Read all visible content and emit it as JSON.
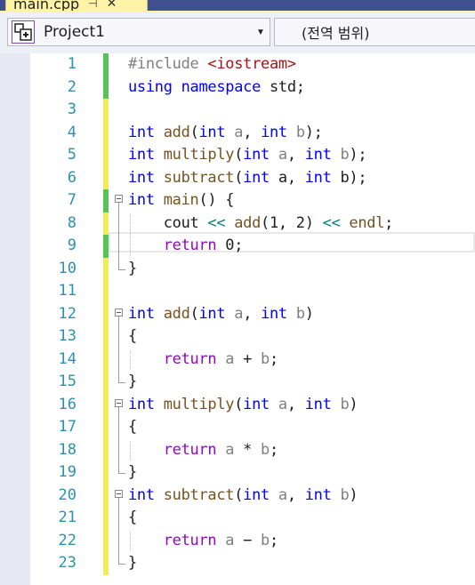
{
  "tab": {
    "filename": "main.cpp",
    "pin_glyph": "⊣",
    "close_glyph": "✕"
  },
  "navbar": {
    "project": "Project1",
    "scope": "(전역 범위)"
  },
  "colors": {
    "keyword": "#0000ff",
    "function": "#74531f",
    "preprocessor": "#808080",
    "string": "#a31515",
    "param": "#808080",
    "control": "#8f08c4",
    "line_number": "#2b91af",
    "change_saved": "#57c15c",
    "change_unsaved": "#f1ec5a"
  },
  "lines": [
    {
      "n": "1",
      "change": "saved",
      "tokens": [
        [
          "pp",
          "#include "
        ],
        [
          "str",
          "<iostream>"
        ]
      ]
    },
    {
      "n": "2",
      "change": "saved",
      "tokens": [
        [
          "kw",
          "using"
        ],
        [
          "id",
          " "
        ],
        [
          "kw",
          "namespace"
        ],
        [
          "id",
          " std;"
        ]
      ]
    },
    {
      "n": "3",
      "change": "unsaved",
      "tokens": []
    },
    {
      "n": "4",
      "change": "unsaved",
      "tokens": [
        [
          "kw",
          "int"
        ],
        [
          "id",
          " "
        ],
        [
          "fn",
          "add"
        ],
        [
          "id",
          "("
        ],
        [
          "kw",
          "int"
        ],
        [
          "id",
          " "
        ],
        [
          "par",
          "a"
        ],
        [
          "id",
          ", "
        ],
        [
          "kw",
          "int"
        ],
        [
          "id",
          " "
        ],
        [
          "par",
          "b"
        ],
        [
          "id",
          ");"
        ]
      ]
    },
    {
      "n": "5",
      "change": "unsaved",
      "tokens": [
        [
          "kw",
          "int"
        ],
        [
          "id",
          " "
        ],
        [
          "fn",
          "multiply"
        ],
        [
          "id",
          "("
        ],
        [
          "kw",
          "int"
        ],
        [
          "id",
          " "
        ],
        [
          "par",
          "a"
        ],
        [
          "id",
          ", "
        ],
        [
          "kw",
          "int"
        ],
        [
          "id",
          " "
        ],
        [
          "par",
          "b"
        ],
        [
          "id",
          ");"
        ]
      ]
    },
    {
      "n": "6",
      "change": "unsaved",
      "tokens": [
        [
          "kw",
          "int"
        ],
        [
          "id",
          " "
        ],
        [
          "fn",
          "subtract"
        ],
        [
          "id",
          "("
        ],
        [
          "kw",
          "int"
        ],
        [
          "id",
          " a, "
        ],
        [
          "kw",
          "int"
        ],
        [
          "id",
          " b);"
        ]
      ]
    },
    {
      "n": "7",
      "change": "saved",
      "tokens": [
        [
          "kw",
          "int"
        ],
        [
          "id",
          " "
        ],
        [
          "fn",
          "main"
        ],
        [
          "id",
          "() {"
        ]
      ]
    },
    {
      "n": "8",
      "change": "unsaved",
      "tokens": [
        [
          "id",
          "    cout "
        ],
        [
          "op",
          "<<"
        ],
        [
          "id",
          " "
        ],
        [
          "fn",
          "add"
        ],
        [
          "id",
          "(1, 2) "
        ],
        [
          "op",
          "<<"
        ],
        [
          "id",
          " "
        ],
        [
          "fn",
          "endl"
        ],
        [
          "id",
          ";"
        ]
      ]
    },
    {
      "n": "9",
      "change": "saved",
      "tokens": [
        [
          "id",
          "    "
        ],
        [
          "ctl",
          "return"
        ],
        [
          "id",
          " 0;"
        ]
      ]
    },
    {
      "n": "10",
      "change": "unsaved",
      "tokens": [
        [
          "id",
          "}"
        ]
      ]
    },
    {
      "n": "11",
      "change": "unsaved",
      "tokens": []
    },
    {
      "n": "12",
      "change": "unsaved",
      "tokens": [
        [
          "kw",
          "int"
        ],
        [
          "id",
          " "
        ],
        [
          "fn",
          "add"
        ],
        [
          "id",
          "("
        ],
        [
          "kw",
          "int"
        ],
        [
          "id",
          " "
        ],
        [
          "par",
          "a"
        ],
        [
          "id",
          ", "
        ],
        [
          "kw",
          "int"
        ],
        [
          "id",
          " "
        ],
        [
          "par",
          "b"
        ],
        [
          "id",
          ")"
        ]
      ]
    },
    {
      "n": "13",
      "change": "unsaved",
      "tokens": [
        [
          "id",
          "{"
        ]
      ]
    },
    {
      "n": "14",
      "change": "unsaved",
      "tokens": [
        [
          "id",
          "    "
        ],
        [
          "ctl",
          "return"
        ],
        [
          "id",
          " "
        ],
        [
          "par",
          "a"
        ],
        [
          "id",
          " + "
        ],
        [
          "par",
          "b"
        ],
        [
          "id",
          ";"
        ]
      ]
    },
    {
      "n": "15",
      "change": "unsaved",
      "tokens": [
        [
          "id",
          "}"
        ]
      ]
    },
    {
      "n": "16",
      "change": "unsaved",
      "tokens": [
        [
          "kw",
          "int"
        ],
        [
          "id",
          " "
        ],
        [
          "fn",
          "multiply"
        ],
        [
          "id",
          "("
        ],
        [
          "kw",
          "int"
        ],
        [
          "id",
          " "
        ],
        [
          "par",
          "a"
        ],
        [
          "id",
          ", "
        ],
        [
          "kw",
          "int"
        ],
        [
          "id",
          " "
        ],
        [
          "par",
          "b"
        ],
        [
          "id",
          ")"
        ]
      ]
    },
    {
      "n": "17",
      "change": "unsaved",
      "tokens": [
        [
          "id",
          "{"
        ]
      ]
    },
    {
      "n": "18",
      "change": "unsaved",
      "tokens": [
        [
          "id",
          "    "
        ],
        [
          "ctl",
          "return"
        ],
        [
          "id",
          " "
        ],
        [
          "par",
          "a"
        ],
        [
          "id",
          " * "
        ],
        [
          "par",
          "b"
        ],
        [
          "id",
          ";"
        ]
      ]
    },
    {
      "n": "19",
      "change": "unsaved",
      "tokens": [
        [
          "id",
          "}"
        ]
      ]
    },
    {
      "n": "20",
      "change": "unsaved",
      "tokens": [
        [
          "kw",
          "int"
        ],
        [
          "id",
          " "
        ],
        [
          "fn",
          "subtract"
        ],
        [
          "id",
          "("
        ],
        [
          "kw",
          "int"
        ],
        [
          "id",
          " "
        ],
        [
          "par",
          "a"
        ],
        [
          "id",
          ", "
        ],
        [
          "kw",
          "int"
        ],
        [
          "id",
          " "
        ],
        [
          "par",
          "b"
        ],
        [
          "id",
          ")"
        ]
      ]
    },
    {
      "n": "21",
      "change": "unsaved",
      "tokens": [
        [
          "id",
          "{"
        ]
      ]
    },
    {
      "n": "22",
      "change": "unsaved",
      "tokens": [
        [
          "id",
          "    "
        ],
        [
          "ctl",
          "return"
        ],
        [
          "id",
          " "
        ],
        [
          "par",
          "a"
        ],
        [
          "id",
          " − "
        ],
        [
          "par",
          "b"
        ],
        [
          "id",
          ";"
        ]
      ]
    },
    {
      "n": "23",
      "change": "unsaved",
      "tokens": [
        [
          "id",
          "}"
        ]
      ]
    }
  ]
}
